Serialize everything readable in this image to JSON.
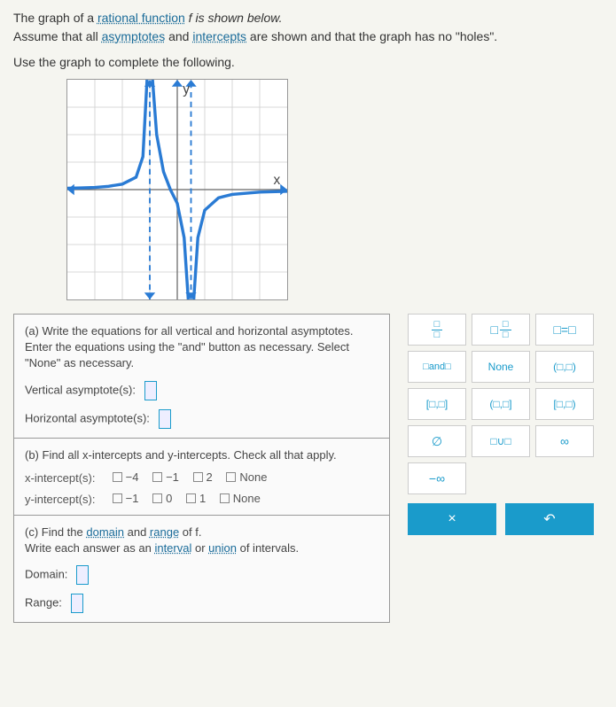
{
  "prompt": {
    "line1a": "The graph of a ",
    "rational": "rational function",
    "line1b": " f is shown below.",
    "line2a": "Assume that all ",
    "asymptotes": "asymptotes",
    "line2b": " and ",
    "intercepts": "intercepts",
    "line2c": " are shown and that the graph has no \"holes\".",
    "line3": "Use the graph to complete the following."
  },
  "partA": {
    "lead": "(a) Write the equations for all vertical and horizontal asymptotes. Enter the equations using the \"and\" button as necessary. Select \"None\" as necessary.",
    "vert_label": "Vertical asymptote(s):",
    "horiz_label": "Horizontal asymptote(s):"
  },
  "partB": {
    "lead": "(b) Find all x-intercepts and y-intercepts. Check all that apply.",
    "x_label": "x-intercept(s):",
    "x_opts": [
      "−4",
      "−1",
      "2",
      "None"
    ],
    "y_label": "y-intercept(s):",
    "y_opts": [
      "−1",
      "0",
      "1",
      "None"
    ]
  },
  "partC": {
    "lead_a": "(c) Find the ",
    "domain": "domain",
    "and": " and ",
    "range": "range",
    "lead_b": " of f.",
    "sub_a": "Write each answer as an ",
    "interval": "interval",
    "or": " or ",
    "union": "union",
    "sub_b": " of intervals.",
    "domain_label": "Domain:",
    "range_label": "Range:"
  },
  "palette": {
    "frac": {
      "n": "□",
      "d": "□"
    },
    "mixfrac": "□",
    "eq": "□=□",
    "and": "□and□",
    "none": "None",
    "open": "(□,□)",
    "closed": "[□,□]",
    "halfopen": "(□,□]",
    "halfclosed": "[□,□)",
    "empty": "∅",
    "union": "□∪□",
    "inf": "∞",
    "ninf": "−∞",
    "close": "×",
    "reset": "↶"
  },
  "chart_data": {
    "type": "line",
    "title": "",
    "xlabel": "x",
    "ylabel": "y",
    "xlim": [
      -8,
      8
    ],
    "ylim": [
      -8,
      8
    ],
    "vertical_asymptotes": [
      -2,
      1
    ],
    "horizontal_asymptotes": [
      0
    ],
    "branches": [
      {
        "name": "left",
        "x": [
          -8,
          -7,
          -6,
          -5,
          -4,
          -3,
          -2.5,
          -2.2
        ],
        "y": [
          0.1,
          0.12,
          0.16,
          0.24,
          0.4,
          0.9,
          2.4,
          8
        ]
      },
      {
        "name": "middle",
        "x": [
          -1.8,
          -1.5,
          -1,
          -0.5,
          0,
          0.5,
          0.8
        ],
        "y": [
          8,
          4,
          1.3,
          0,
          -1,
          -3.5,
          -8
        ]
      },
      {
        "name": "right",
        "x": [
          1.2,
          1.5,
          2,
          3,
          4,
          6,
          8
        ],
        "y": [
          -8,
          -3.5,
          -1.5,
          -0.6,
          -0.35,
          -0.18,
          -0.12
        ]
      }
    ]
  }
}
